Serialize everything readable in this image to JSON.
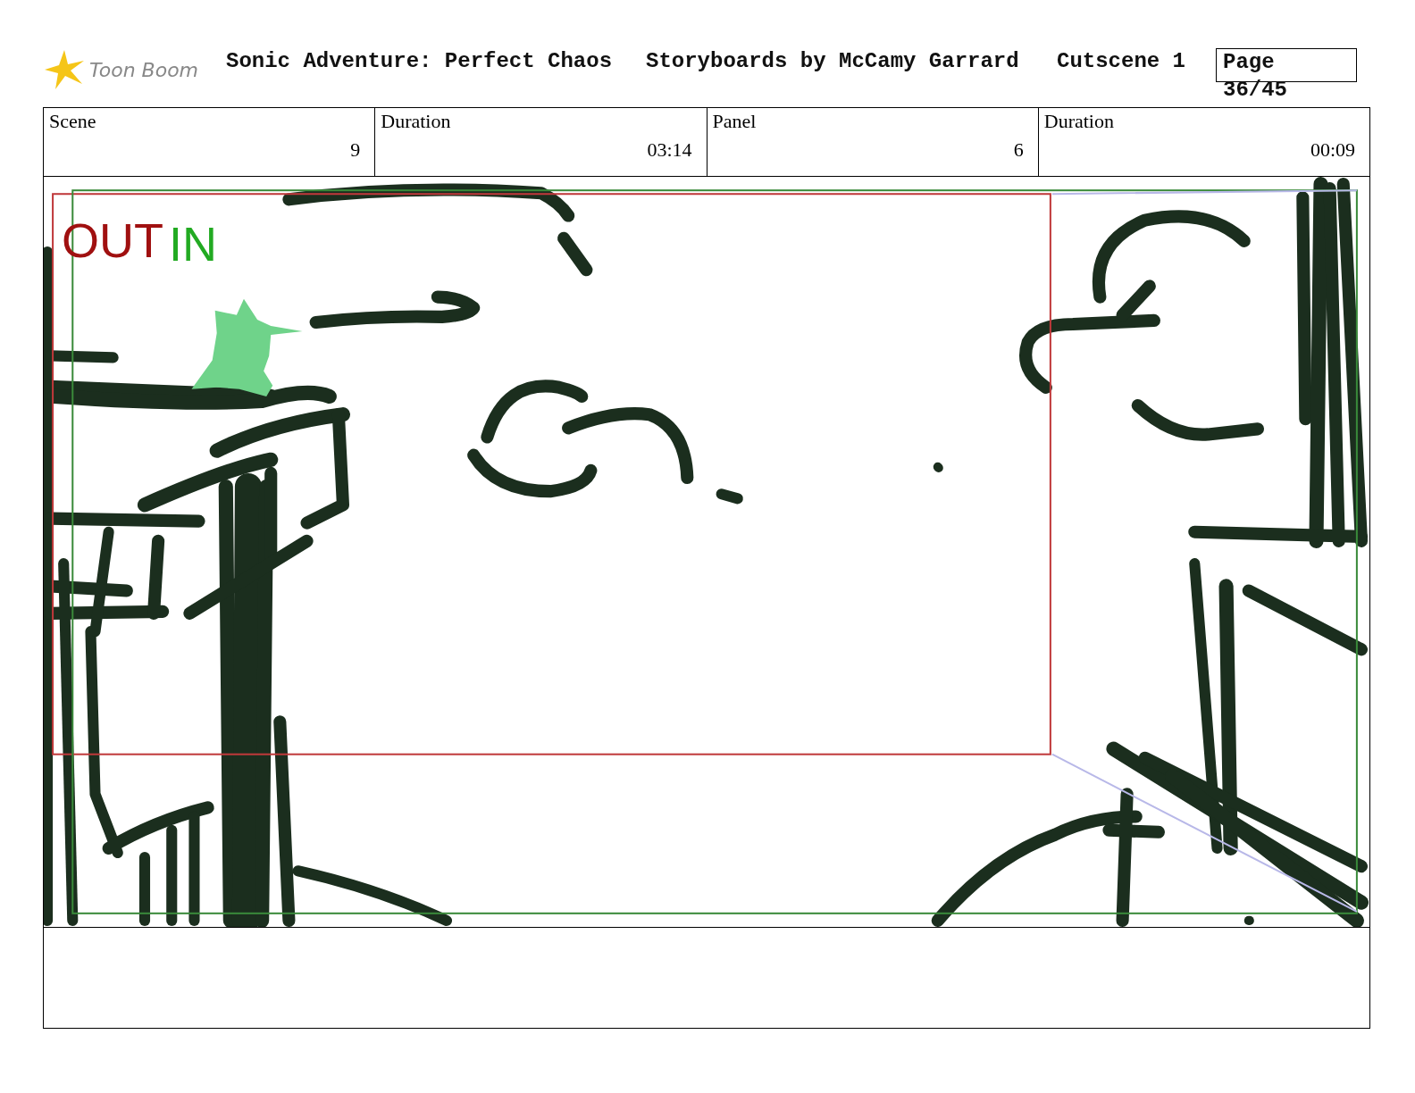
{
  "header": {
    "logo_text": "Toon Boom",
    "title": "Sonic Adventure: Perfect Chaos",
    "credit": "Storyboards by McCamy Garrard",
    "sequence": "Cutscene 1",
    "page_label": "Page",
    "page_number": "36/45"
  },
  "info": [
    {
      "label": "Scene",
      "value": "9"
    },
    {
      "label": "Duration",
      "value": "03:14"
    },
    {
      "label": "Panel",
      "value": "6"
    },
    {
      "label": "Duration",
      "value": "00:09"
    }
  ],
  "panel": {
    "frame_labels": [
      {
        "kind": "out",
        "text": "OUT"
      },
      {
        "kind": "in",
        "text": "IN"
      }
    ]
  }
}
